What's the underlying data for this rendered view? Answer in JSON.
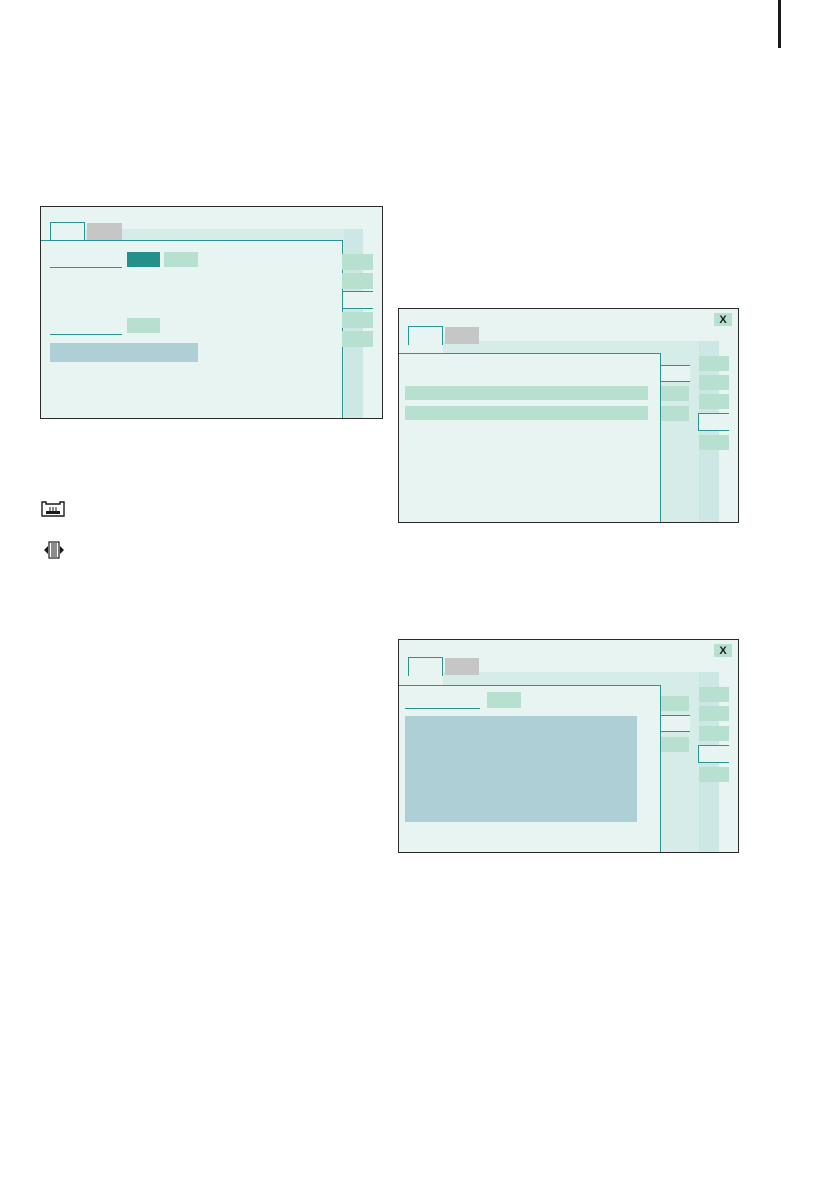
{
  "screens": [
    {
      "name": "screen-1",
      "has_close": false
    },
    {
      "name": "screen-2",
      "has_close": true,
      "close_label": "X"
    },
    {
      "name": "screen-3",
      "has_close": true,
      "close_label": "X"
    }
  ],
  "icons": [
    {
      "name": "tray-icon"
    },
    {
      "name": "grid-arrow-icon"
    }
  ],
  "colors": {
    "accent": "#2a9490",
    "accent_dark": "#23908a",
    "panel_bg": "#e8f4f1",
    "button_light": "#b7e0d1",
    "field_blue": "#aecfd6",
    "tab_inactive": "#c6c6c6"
  }
}
